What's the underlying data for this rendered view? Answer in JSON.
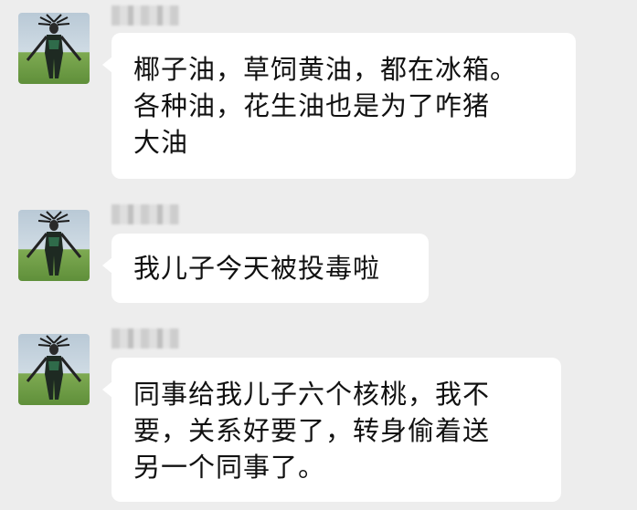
{
  "chat": {
    "messages": [
      {
        "sender": "",
        "avatar_icon": "horned-figure-avatar-icon",
        "lines": [
          "椰子油，草饲黄油，都在冰箱。",
          "各种油，花生油也是为了咋猪",
          "大油"
        ]
      },
      {
        "sender": "",
        "avatar_icon": "horned-figure-avatar-icon",
        "lines": [
          "我儿子今天被投毒啦"
        ]
      },
      {
        "sender": "",
        "avatar_icon": "horned-figure-avatar-icon",
        "lines": [
          "同事给我儿子六个核桃，我不",
          "要，关系好要了，转身偷着送",
          "另一个同事了。"
        ]
      }
    ]
  },
  "colors": {
    "background": "#ededed",
    "bubble": "#ffffff",
    "text": "#111111"
  }
}
